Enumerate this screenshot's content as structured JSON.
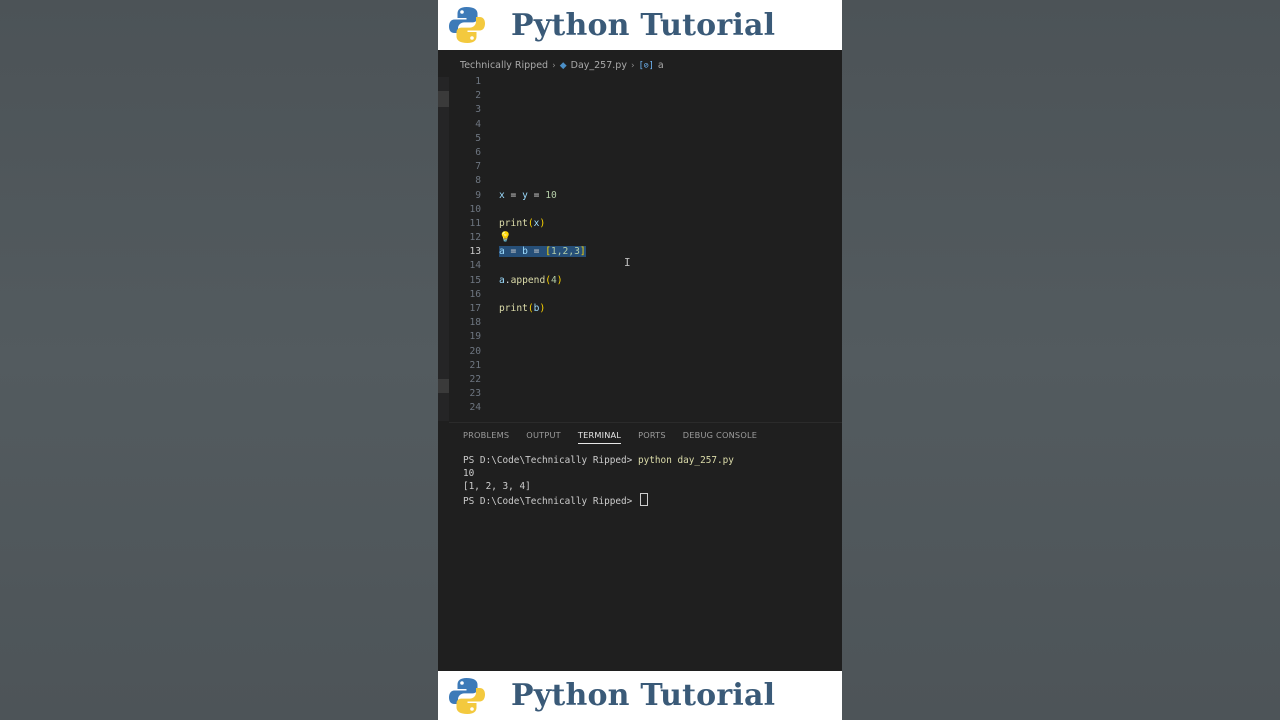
{
  "banner": {
    "title": "Python Tutorial",
    "logo_icon": "python-logo-icon"
  },
  "breadcrumb": {
    "folder": "Technically Ripped",
    "file": "Day_257.py",
    "symbol_glyph": "[⊘]",
    "symbol": "a"
  },
  "editor": {
    "active_line": 13,
    "lines": [
      {
        "n": "1"
      },
      {
        "n": "2"
      },
      {
        "n": "3"
      },
      {
        "n": "4"
      },
      {
        "n": "5"
      },
      {
        "n": "6"
      },
      {
        "n": "7"
      },
      {
        "n": "8"
      },
      {
        "n": "9"
      },
      {
        "n": "10"
      },
      {
        "n": "11"
      },
      {
        "n": "12"
      },
      {
        "n": "13"
      },
      {
        "n": "14"
      },
      {
        "n": "15"
      },
      {
        "n": "16"
      },
      {
        "n": "17"
      },
      {
        "n": "18"
      },
      {
        "n": "19"
      },
      {
        "n": "20"
      },
      {
        "n": "21"
      },
      {
        "n": "22"
      },
      {
        "n": "23"
      },
      {
        "n": "24"
      }
    ],
    "code": {
      "line9": [
        "x",
        " = ",
        "y",
        " = ",
        "10"
      ],
      "line11": [
        "print",
        "(",
        "x",
        ")"
      ],
      "line13": [
        "a",
        " = ",
        "b",
        " = ",
        "[",
        "1,2,3",
        "]"
      ],
      "line15": [
        "a",
        ".",
        "append",
        "(",
        "4",
        ")"
      ],
      "line17": [
        "print",
        "(",
        "b",
        ")"
      ]
    },
    "ibeam": "I"
  },
  "panel": {
    "tabs": [
      "PROBLEMS",
      "OUTPUT",
      "TERMINAL",
      "PORTS",
      "DEBUG CONSOLE"
    ],
    "active_tab": "TERMINAL",
    "terminal": {
      "prompt": "PS D:\\Code\\Technically Ripped> ",
      "command": "python day_257.py",
      "output1": "10",
      "output2": "[1, 2, 3, 4]",
      "prompt2": "PS D:\\Code\\Technically Ripped> "
    }
  },
  "colors": {
    "banner_text": "#3a5a78",
    "editor_bg": "#1f1f1f",
    "selection": "#264f78",
    "page_bg": "#525a5e"
  }
}
